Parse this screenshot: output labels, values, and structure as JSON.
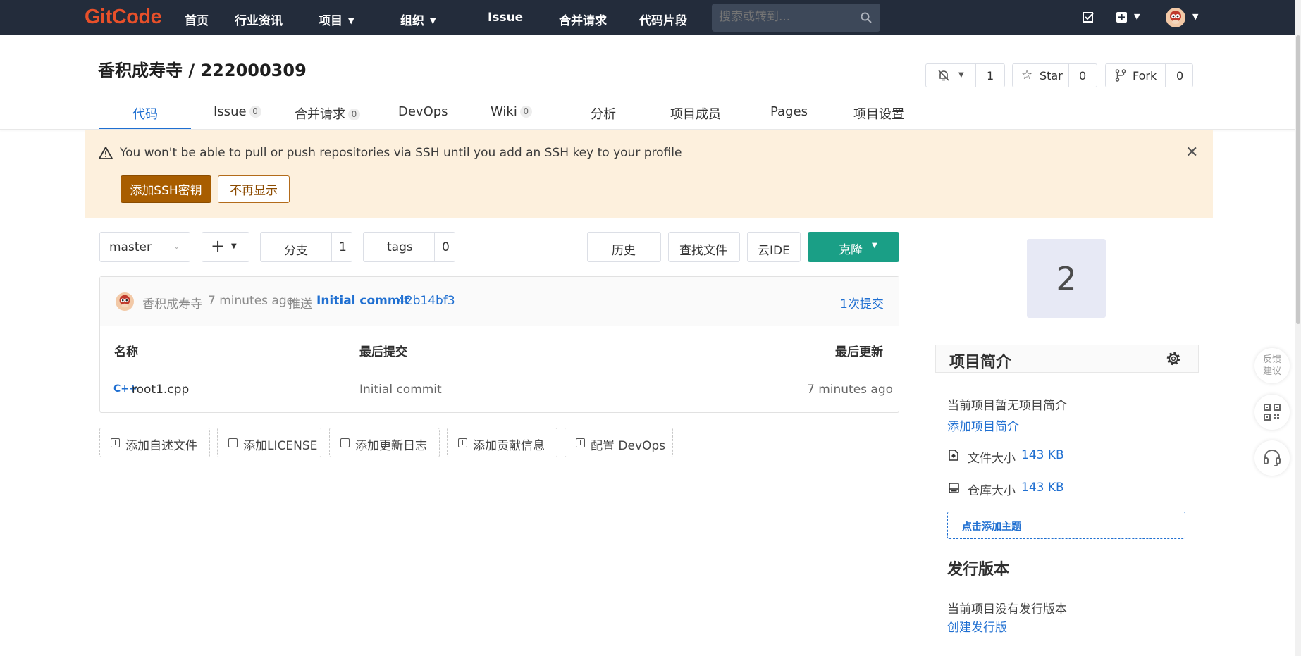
{
  "nav": {
    "logo": "GitCode",
    "items": [
      {
        "label": "首页"
      },
      {
        "label": "行业资讯"
      },
      {
        "label": "项目"
      },
      {
        "label": "组织"
      },
      {
        "label": "Issue"
      },
      {
        "label": "合并请求"
      },
      {
        "label": "代码片段"
      }
    ],
    "search_placeholder": "搜索或转到..."
  },
  "project": {
    "title": "香积成寿寺 / 222000309",
    "notify_count": "1",
    "star_label": "Star",
    "star_count": "0",
    "fork_label": "Fork",
    "fork_count": "0"
  },
  "tabs": [
    {
      "label": "代码"
    },
    {
      "label": "Issue",
      "badge": "0"
    },
    {
      "label": "合并请求",
      "badge": "0"
    },
    {
      "label": "DevOps"
    },
    {
      "label": "Wiki",
      "badge": "0"
    },
    {
      "label": "分析"
    },
    {
      "label": "项目成员"
    },
    {
      "label": "Pages"
    },
    {
      "label": "项目设置"
    }
  ],
  "alert": {
    "message": "You won't be able to pull or push repositories via SSH until you add an SSH key to your profile",
    "primary": "添加SSH密钥",
    "secondary": "不再显示"
  },
  "toolbar": {
    "branch": "master",
    "branches_label": "分支",
    "branches_count": "1",
    "tags_label": "tags",
    "tags_count": "0",
    "history": "历史",
    "find_file": "查找文件",
    "cloud_ide": "云IDE",
    "clone": "克隆"
  },
  "commit": {
    "author": "香积成寿寺",
    "time": "7 minutes ago",
    "action": "推送",
    "message": "Initial commit",
    "sha": "42b14bf3",
    "count_label": "1次提交"
  },
  "table": {
    "headers": [
      "名称",
      "最后提交",
      "最后更新"
    ],
    "rows": [
      {
        "name": "root1.cpp",
        "commit": "Initial commit",
        "updated": "7 minutes ago"
      }
    ]
  },
  "add_files": [
    "添加自述文件",
    "添加LICENSE",
    "添加更新日志",
    "添加贡献信息",
    "配置 DevOps"
  ],
  "sidebar": {
    "avatar_letter": "2",
    "intro_title": "项目简介",
    "no_intro": "当前项目暂无项目简介",
    "add_intro": "添加项目简介",
    "file_size_label": "文件大小",
    "file_size": "143 KB",
    "repo_size_label": "仓库大小",
    "repo_size": "143 KB",
    "add_topic": "点击添加主题",
    "release_title": "发行版本",
    "no_release": "当前项目没有发行版本",
    "create_release": "创建发行版"
  },
  "float": {
    "feedback": "反馈\n建议"
  },
  "colors": {
    "nav_bg": "#232c3b",
    "accent": "#1f6fd1",
    "clone_bg": "#1a9f86",
    "alert_bg": "#fdf0dd",
    "ssh_btn": "#a85d00",
    "logo": "#e8502a"
  }
}
